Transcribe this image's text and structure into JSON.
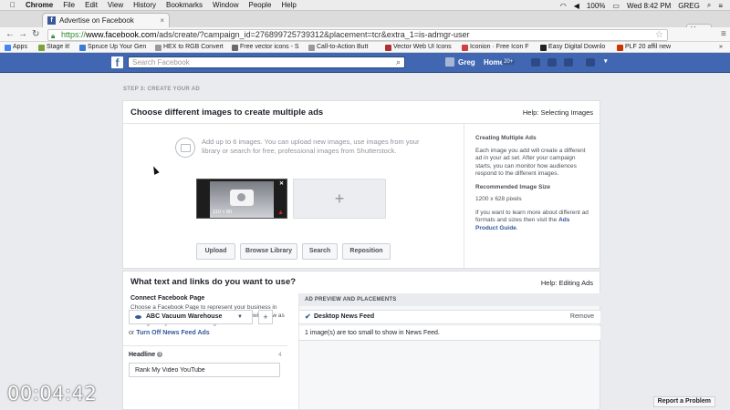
{
  "mac_menu": {
    "app": "Chrome",
    "items": [
      "File",
      "Edit",
      "View",
      "History",
      "Bookmarks",
      "Window",
      "People",
      "Help"
    ],
    "battery": "100%",
    "clock": "Wed 8:42 PM",
    "user": "GREG"
  },
  "browser": {
    "tab_title": "Advertise on Facebook",
    "profile": "You",
    "url_scheme": "https://",
    "url_host": "www.facebook.com",
    "url_path": "/ads/create/?campaign_id=276899725739312&placement=tcr&extra_1=is-admgr-user",
    "bookmarks": [
      {
        "label": "Apps",
        "color": "#4285f4"
      },
      {
        "label": "Stage it!",
        "color": "#7aa33c"
      },
      {
        "label": "Spruce Up Your Gen",
        "color": "#3c7bd4"
      },
      {
        "label": "HEX to RGB Convert",
        "color": "#999999"
      },
      {
        "label": "Free vector icons - S",
        "color": "#6a6a6a"
      },
      {
        "label": "Call-to-Action Butt",
        "color": "#999999"
      },
      {
        "label": "Vector Web UI Icons",
        "color": "#b03030"
      },
      {
        "label": "Iconion · Free Icon F",
        "color": "#d04040"
      },
      {
        "label": "Easy Digital Downlo",
        "color": "#222222"
      },
      {
        "label": "PLF 20 affil new",
        "color": "#cc3300"
      }
    ]
  },
  "fb_header": {
    "logo": "f",
    "search_placeholder": "Search Facebook",
    "user_name": "Greg",
    "home_label": "Home",
    "home_count": "20+"
  },
  "step_label": "STEP 3: CREATE YOUR AD",
  "images_section": {
    "title": "Choose different images to create multiple ads",
    "help": "Help: Selecting Images",
    "upload_text": "Add up to 6 images. You can upload new images, use images from your library or search for free, professional images from Shutterstock.",
    "thumb_dims": "110 × 80",
    "add_symbol": "+",
    "buttons": [
      "Upload",
      "Browse Library",
      "Search",
      "Reposition"
    ],
    "side_title": "Creating Multiple Ads",
    "side_text": "Each image you add will create a different ad in your ad set. After your campaign starts, you can monitor how audiences respond to the different images.",
    "side_rec_title": "Recommended Image Size",
    "side_rec_size": "1200 x 628 pixels",
    "side_more": "If you want to learn more about different ad formats and sizes then visit the",
    "side_link": "Ads Product Guide",
    "side_end": "."
  },
  "links_section": {
    "title": "What text and links do you want to use?",
    "help": "Help: Editing Ads",
    "connect_label": "Connect Facebook Page",
    "connect_desc": "Choose a Facebook Page to represent your business in News Feed. Your ad will link to your site, but it will show as coming from your Facebook Page.",
    "page_selected": "ABC Vacuum Warehouse",
    "turn_off_prefix": "or",
    "turn_off_link": "Turn Off News Feed Ads",
    "headline_label": "Headline",
    "headline_count": "4",
    "headline_value": "Rank My Video YouTube",
    "preview_header": "AD PREVIEW AND PLACEMENTS",
    "placement": "Desktop News Feed",
    "remove": "Remove",
    "preview_msg": "1 image(s) are too small to show in News Feed."
  },
  "overlay": {
    "timer": "00:04:42",
    "report": "Report a Problem"
  }
}
